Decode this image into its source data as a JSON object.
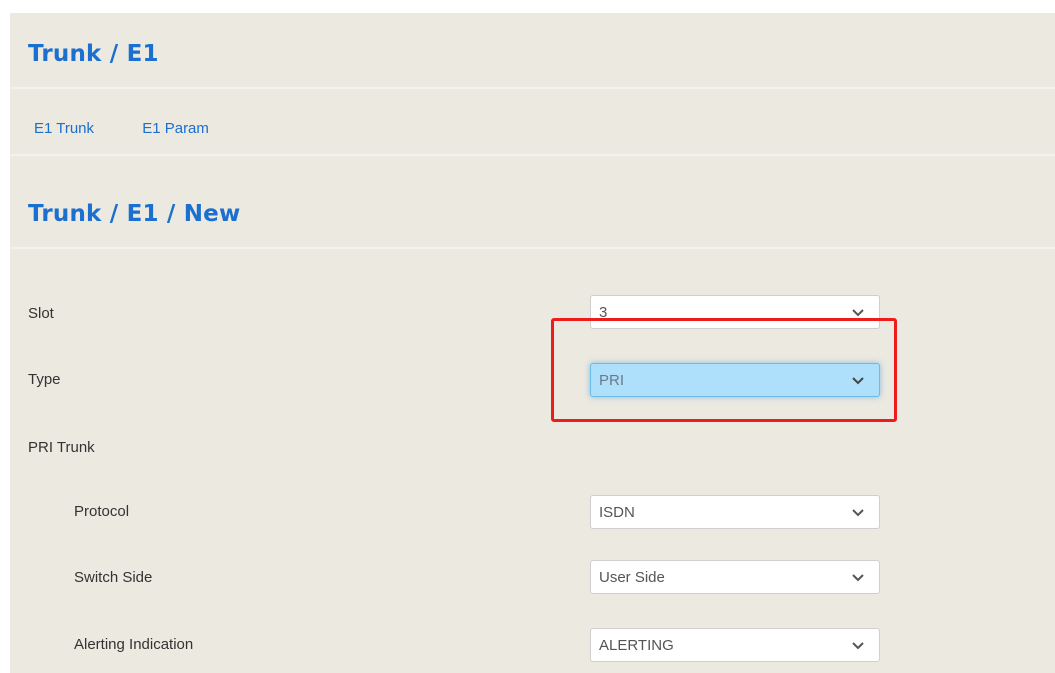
{
  "header": {
    "title": "Trunk / E1"
  },
  "tabs": [
    {
      "label": "E1 Trunk"
    },
    {
      "label": "E1 Param"
    }
  ],
  "section": {
    "title": "Trunk / E1 / New"
  },
  "form": {
    "slot": {
      "label": "Slot",
      "value": "3"
    },
    "type": {
      "label": "Type",
      "value": "PRI"
    },
    "pri_trunk": {
      "label": "PRI Trunk"
    },
    "protocol": {
      "label": "Protocol",
      "value": "ISDN"
    },
    "switch_side": {
      "label": "Switch Side",
      "value": "User Side"
    },
    "alerting_indication": {
      "label": "Alerting Indication",
      "value": "ALERTING"
    }
  },
  "colors": {
    "accent": "#1a6fcf",
    "panel_background": "#ebe9e0",
    "active_select": "#aee0fb",
    "highlight_box": "#ee1c1c"
  }
}
